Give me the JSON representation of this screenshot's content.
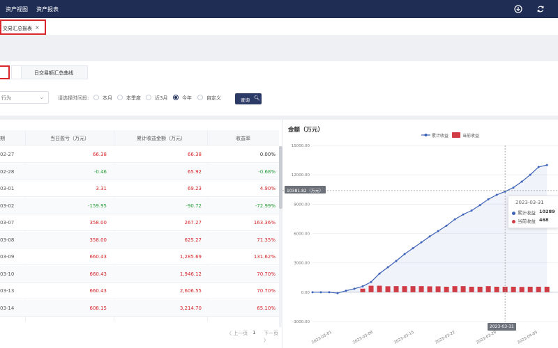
{
  "topbar": {
    "menus": [
      "资产视图",
      "资产报表"
    ]
  },
  "tabs": [
    {
      "label": "交易汇总报表",
      "close": "×"
    }
  ],
  "segment": {
    "label": "日交易额汇总曲线"
  },
  "filter": {
    "select_value": "行为",
    "time_label": "请选择时间段:",
    "options": [
      "本月",
      "本季度",
      "近3月",
      "今年",
      "自定义"
    ],
    "selected": "今年",
    "query_label": "查询"
  },
  "table": {
    "headers": [
      "期",
      "当日盈亏（万元）",
      "累计收益金额（万元）",
      "收益率"
    ],
    "rows": [
      [
        "02-27",
        "66.38",
        "66.38",
        "0.00%"
      ],
      [
        "02-28",
        "-0.46",
        "65.92",
        "-0.68%"
      ],
      [
        "03-01",
        "3.31",
        "69.23",
        "4.90%"
      ],
      [
        "03-02",
        "-159.95",
        "-90.72",
        "-72.99%"
      ],
      [
        "03-07",
        "358.00",
        "267.27",
        "163.36%"
      ],
      [
        "03-08",
        "358.00",
        "625.27",
        "71.35%"
      ],
      [
        "03-09",
        "660.43",
        "1,285.69",
        "131.62%"
      ],
      [
        "03-10",
        "660.43",
        "1,946.12",
        "70.70%"
      ],
      [
        "03-13",
        "660.43",
        "2,606.55",
        "70.70%"
      ],
      [
        "03-14",
        "608.15",
        "3,214.70",
        "65.10%"
      ]
    ],
    "pager": {
      "prev": "〈 上一页",
      "page": "1",
      "next": "下一页 〉"
    }
  },
  "chart_data": {
    "type": "line",
    "title": "金额（万元）",
    "legend": [
      "累计收益",
      "当前收益"
    ],
    "y_ticks": [
      "15000.00",
      "12000.00",
      "9000.00",
      "6000.00",
      "3000.00",
      "0.00",
      "-3000.00"
    ],
    "ylim": [
      -3000,
      15000
    ],
    "x_ticks": [
      "2023-03-01",
      "2023-03-08",
      "2023-03-15",
      "2023-03-22",
      "2023-03-29",
      "2023-04-05"
    ],
    "series": [
      {
        "name": "累计收益",
        "color": "#3d62b7",
        "values": [
          0,
          0,
          0,
          -100,
          150,
          350,
          600,
          1050,
          1900,
          2550,
          3200,
          3900,
          4500,
          5100,
          5700,
          6250,
          6800,
          7450,
          7950,
          8350,
          8900,
          9500,
          9950,
          10289,
          10700,
          11300,
          12000,
          12800,
          13000
        ]
      },
      {
        "name": "当前收益",
        "color": "#d13b45",
        "values": [
          0,
          0,
          0,
          0,
          0,
          0,
          360,
          660,
          660,
          608,
          620,
          620,
          620,
          620,
          600,
          600,
          560,
          620,
          620,
          560,
          560,
          620,
          560,
          560,
          560,
          540,
          560,
          560,
          560
        ]
      }
    ],
    "crosshair": {
      "y_label": "10381.82（万元）",
      "x_label": "2023-03-31"
    },
    "tooltip": {
      "date": "2023-03-31",
      "rows": [
        {
          "name": "累计收益",
          "value": "10289"
        },
        {
          "name": "当前收益",
          "value": "468"
        }
      ]
    }
  }
}
